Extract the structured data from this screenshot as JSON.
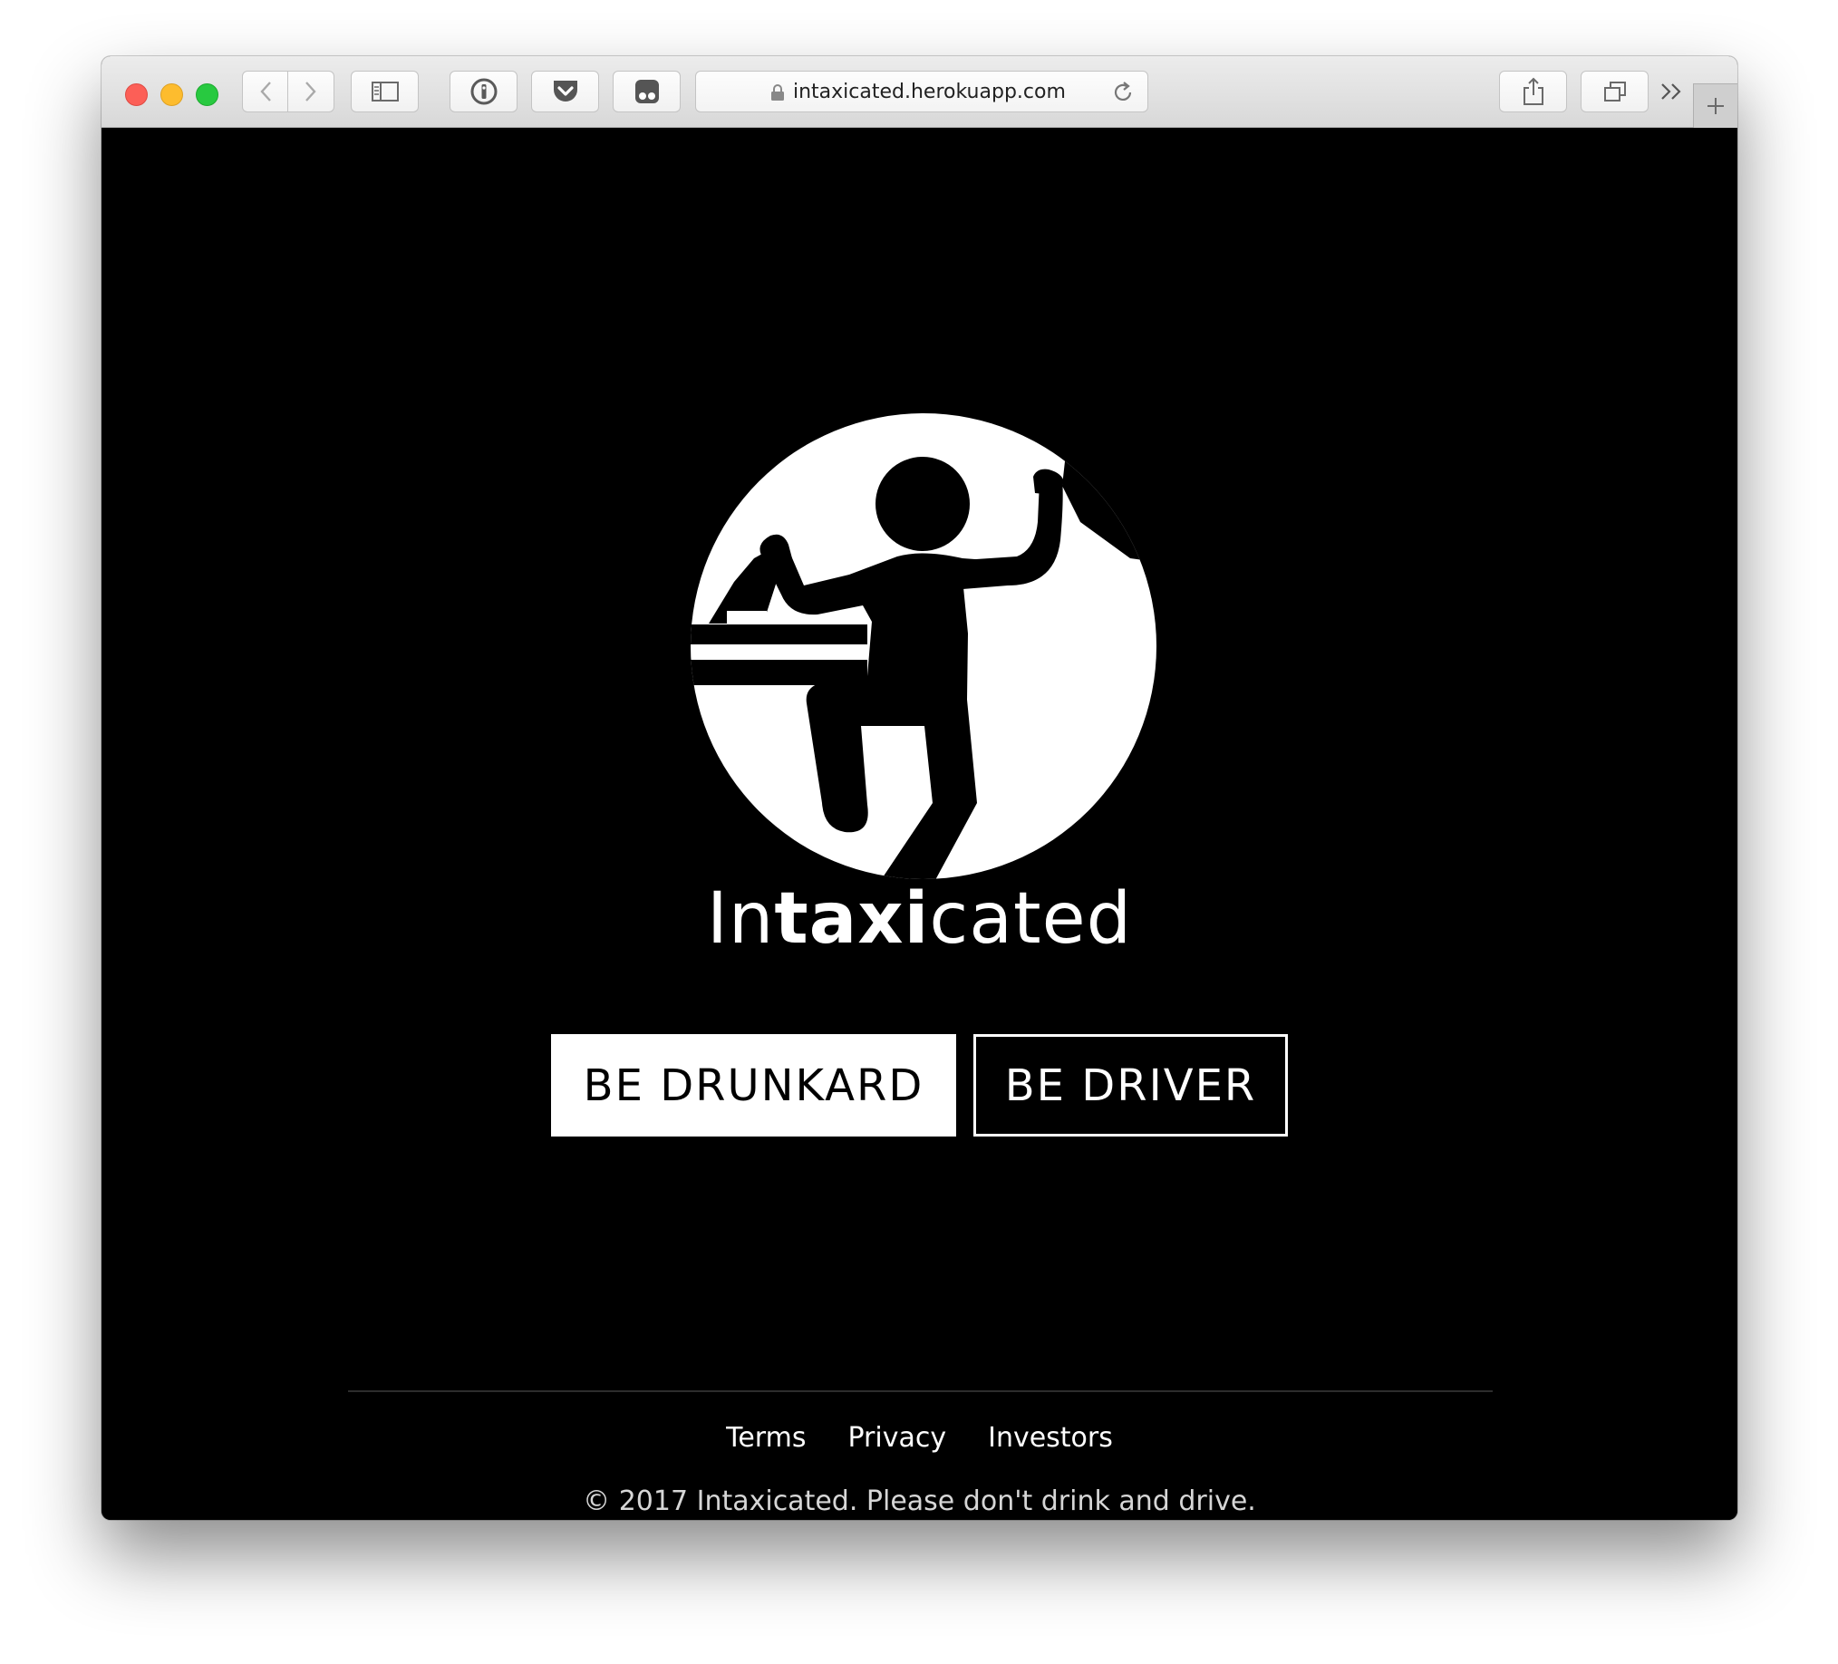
{
  "browser": {
    "url": "intaxicated.herokuapp.com"
  },
  "app": {
    "brand_prefix": "In",
    "brand_bold": "taxi",
    "brand_suffix": "cated",
    "buttons": {
      "drunkard": "BE DRUNKARD",
      "driver": "BE DRIVER"
    },
    "footer": {
      "links": [
        "Terms",
        "Privacy",
        "Investors"
      ],
      "copyright": "© 2017 Intaxicated. Please don't drink and drive."
    }
  },
  "icons": {
    "logo": "drunk-person-icon",
    "back": "chevron-left-icon",
    "forward": "chevron-right-icon",
    "sidebar": "sidebar-icon",
    "password": "password-manager-icon",
    "pocket": "pocket-icon",
    "extension": "ghostery-icon",
    "lock": "lock-icon",
    "reload": "reload-icon",
    "share": "share-icon",
    "tabs": "tabs-overview-icon",
    "more": "double-chevron-icon",
    "new_tab": "plus-icon"
  },
  "colors": {
    "background": "#000000",
    "foreground": "#ffffff"
  }
}
